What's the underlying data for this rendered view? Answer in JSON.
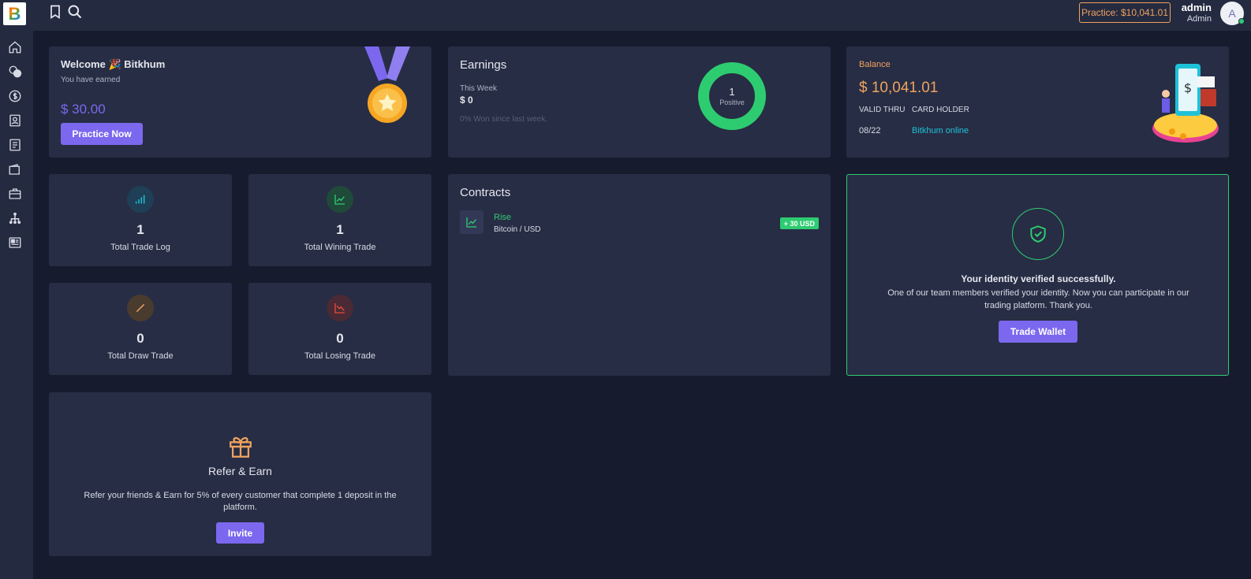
{
  "topbar": {
    "logo_letter": "B",
    "practice_label": "Practice: $10,041.01",
    "user_name": "admin",
    "user_role": "Admin",
    "avatar_initial": "A"
  },
  "welcome": {
    "title": "Welcome",
    "name": "Bitkhum",
    "subtitle": "You have earned",
    "amount": "$ 30.00",
    "button": "Practice Now"
  },
  "earnings": {
    "title": "Earnings",
    "week_label": "This Week",
    "week_value": "$ 0",
    "note": "0% Won since last week.",
    "donut_value": "1",
    "donut_label": "Positive"
  },
  "balance": {
    "label": "Balance",
    "amount": "$ 10,041.01",
    "valid_thru_label": "VALID THRU",
    "card_holder_label": "CARD HOLDER",
    "valid_thru": "08/22",
    "card_holder": "Bitkhum online"
  },
  "stats": [
    {
      "value": "1",
      "label": "Total Trade Log"
    },
    {
      "value": "1",
      "label": "Total Wining Trade"
    },
    {
      "value": "0",
      "label": "Total Draw Trade"
    },
    {
      "value": "0",
      "label": "Total Losing Trade"
    }
  ],
  "contracts": {
    "title": "Contracts",
    "item_type": "Rise",
    "item_pair": "Bitcoin / USD",
    "item_badge": "+ 30 USD"
  },
  "verify": {
    "title": "Your identity verified successfully.",
    "line1": "One of our team members verified your identity. Now you can participate in our",
    "line2": "trading platform. Thank you.",
    "button": "Trade Wallet"
  },
  "refer": {
    "title": "Refer & Earn",
    "line1": "Refer your friends & Earn for 5% of every customer that complete 1 deposit in the",
    "line2": "platform.",
    "button": "Invite"
  },
  "colors": {
    "accent": "#7b68ee",
    "green": "#2ecc71",
    "orange": "#f0a35e",
    "teal": "#1ec1d8",
    "red": "#e74c3c"
  }
}
